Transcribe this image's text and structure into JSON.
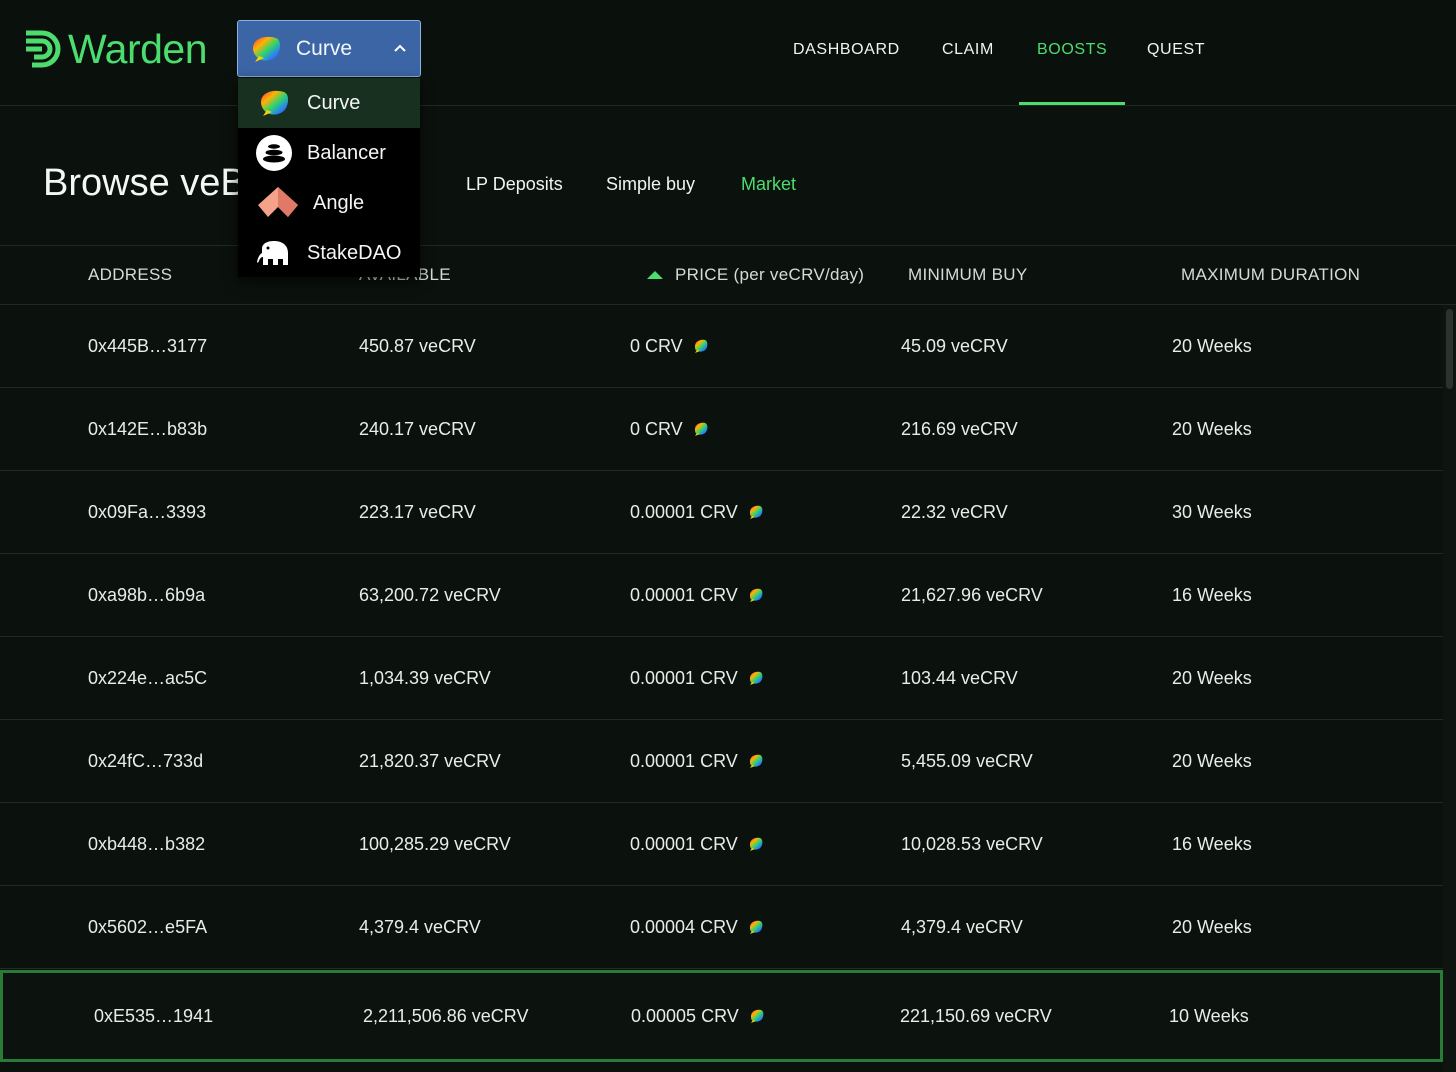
{
  "brand": {
    "name": "Warden",
    "accent": "#4ddc6e"
  },
  "nav": {
    "items": [
      {
        "label": "DASHBOARD",
        "active": false
      },
      {
        "label": "CLAIM",
        "active": false
      },
      {
        "label": "BOOSTS",
        "active": true
      },
      {
        "label": "QUEST",
        "active": false
      }
    ]
  },
  "protocol_select": {
    "selected": "Curve",
    "options": [
      {
        "label": "Curve",
        "icon": "curve-icon"
      },
      {
        "label": "Balancer",
        "icon": "balancer-icon"
      },
      {
        "label": "Angle",
        "icon": "angle-icon"
      },
      {
        "label": "StakeDAO",
        "icon": "stakedao-icon"
      }
    ]
  },
  "page": {
    "title": "Browse veB",
    "tabs": [
      {
        "label": "LP Deposits",
        "active": false
      },
      {
        "label": "Simple buy",
        "active": false
      },
      {
        "label": "Market",
        "active": true
      }
    ]
  },
  "table": {
    "headers": [
      "ADDRESS",
      "AVAILABLE",
      "PRICE (per veCRV/day)",
      "MINIMUM BUY",
      "MAXIMUM DURATION"
    ],
    "visible_available_header": "AVAILABLE",
    "sort": {
      "column": "PRICE (per veCRV/day)",
      "direction": "ascending"
    },
    "rows": [
      {
        "address": "0x445B…3177",
        "available": "450.87 veCRV",
        "price": "0 CRV",
        "min_buy": "45.09 veCRV",
        "duration": "20 Weeks"
      },
      {
        "address": "0x142E…b83b",
        "available": "240.17 veCRV",
        "price": "0 CRV",
        "min_buy": "216.69 veCRV",
        "duration": "20 Weeks"
      },
      {
        "address": "0x09Fa…3393",
        "available": "223.17 veCRV",
        "price": "0.00001 CRV",
        "min_buy": "22.32 veCRV",
        "duration": "30 Weeks"
      },
      {
        "address": "0xa98b…6b9a",
        "available": "63,200.72 veCRV",
        "price": "0.00001 CRV",
        "min_buy": "21,627.96 veCRV",
        "duration": "16 Weeks"
      },
      {
        "address": "0x224e…ac5C",
        "available": "1,034.39 veCRV",
        "price": "0.00001 CRV",
        "min_buy": "103.44 veCRV",
        "duration": "20 Weeks"
      },
      {
        "address": "0x24fC…733d",
        "available": "21,820.37 veCRV",
        "price": "0.00001 CRV",
        "min_buy": "5,455.09 veCRV",
        "duration": "20 Weeks"
      },
      {
        "address": "0xb448…b382",
        "available": "100,285.29 veCRV",
        "price": "0.00001 CRV",
        "min_buy": "10,028.53 veCRV",
        "duration": "16 Weeks"
      },
      {
        "address": "0x5602…e5FA",
        "available": "4,379.4 veCRV",
        "price": "0.00004 CRV",
        "min_buy": "4,379.4 veCRV",
        "duration": "20 Weeks"
      },
      {
        "address": "0xE535…1941",
        "available": "2,211,506.86 veCRV",
        "price": "0.00005 CRV",
        "min_buy": "221,150.69 veCRV",
        "duration": "10 Weeks",
        "highlighted": true
      }
    ]
  }
}
